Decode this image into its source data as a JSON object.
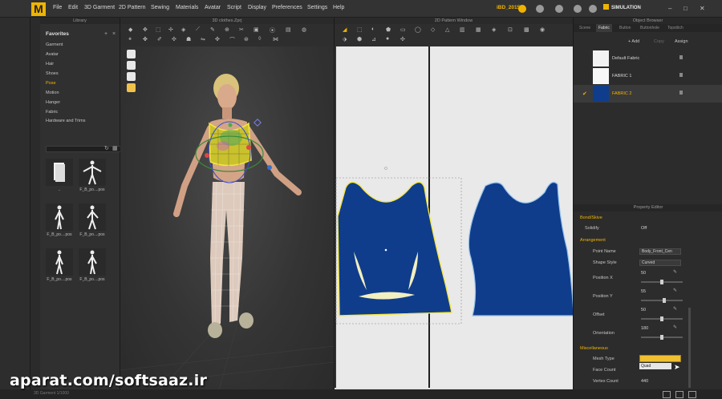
{
  "app": {
    "logo": "M",
    "menu": [
      "File",
      "Edit",
      "3D Garment",
      "2D Pattern",
      "Sewing",
      "Materials",
      "Avatar",
      "Script",
      "Display",
      "Preferences",
      "Settings",
      "Help"
    ],
    "project_name": "iBD_2015",
    "simulation_label": "SIMULATION",
    "window_controls": [
      "–",
      "□",
      "✕"
    ]
  },
  "library": {
    "title": "Library",
    "favorites": "Favorites",
    "items": [
      "Garment",
      "Avatar",
      "Hair",
      "Shoes",
      "Pose",
      "Motion",
      "Hanger",
      "Fabric",
      "Hardware and Trims"
    ],
    "active_item": "Pose",
    "thumbnails": [
      {
        "label": ".."
      },
      {
        "label": "F_B_po....pos"
      },
      {
        "label": "F_B_po....pos"
      },
      {
        "label": "F_B_po....pos"
      },
      {
        "label": "F_B_po....pos"
      },
      {
        "label": "F_B_po....pos"
      }
    ]
  },
  "view3d": {
    "title": "3D clothes.Zprj"
  },
  "view2d": {
    "title": "2D Pattern Window"
  },
  "object_browser": {
    "title": "Object Browser",
    "tabs": [
      "Scene",
      "Fabric",
      "Button",
      "Buttonhole",
      "Topstitch"
    ],
    "active_tab": "Fabric",
    "actions": {
      "add": "+ Add",
      "copy": "Copy",
      "assign": "Assign"
    },
    "fabrics": [
      {
        "name": "Default Fabric",
        "color": "#f2f2f2",
        "selected": false
      },
      {
        "name": "FABRIC 1",
        "color": "#f7f7f7",
        "selected": false
      },
      {
        "name": "FABRIC 2",
        "color": "#0f3d8c",
        "selected": true
      }
    ]
  },
  "property_editor": {
    "title": "Property Editor",
    "sections": {
      "bond": "Bond/Skive",
      "arrangement": "Arrangement",
      "misc": "Miscellaneous"
    },
    "solidify_label": "Solidify",
    "solidify_value": "Off",
    "point_name_label": "Point Name",
    "point_name_value": "Body_Front_Cen",
    "shape_style_label": "Shape Style",
    "shape_style_value": "Curved",
    "position_x_label": "Position X",
    "position_x_value": "50",
    "position_y_label": "Position Y",
    "position_y_value": "55",
    "offset_label": "Offset",
    "offset_value": "50",
    "orientation_label": "Orientation",
    "orientation_value": "180",
    "mesh_type_label": "Mesh Type",
    "mesh_type_option": "Quad",
    "face_count_label": "Face Count",
    "vertex_count_label": "Vertex Count",
    "vertex_count_value": "440"
  },
  "status": {
    "text": "3D Garment    1/1000"
  },
  "watermark": "aparat.com/softsaaz.ir",
  "colors": {
    "accent": "#f0b400",
    "fabric_blue": "#0f3d8c",
    "selection_yellow": "#f5e642"
  }
}
